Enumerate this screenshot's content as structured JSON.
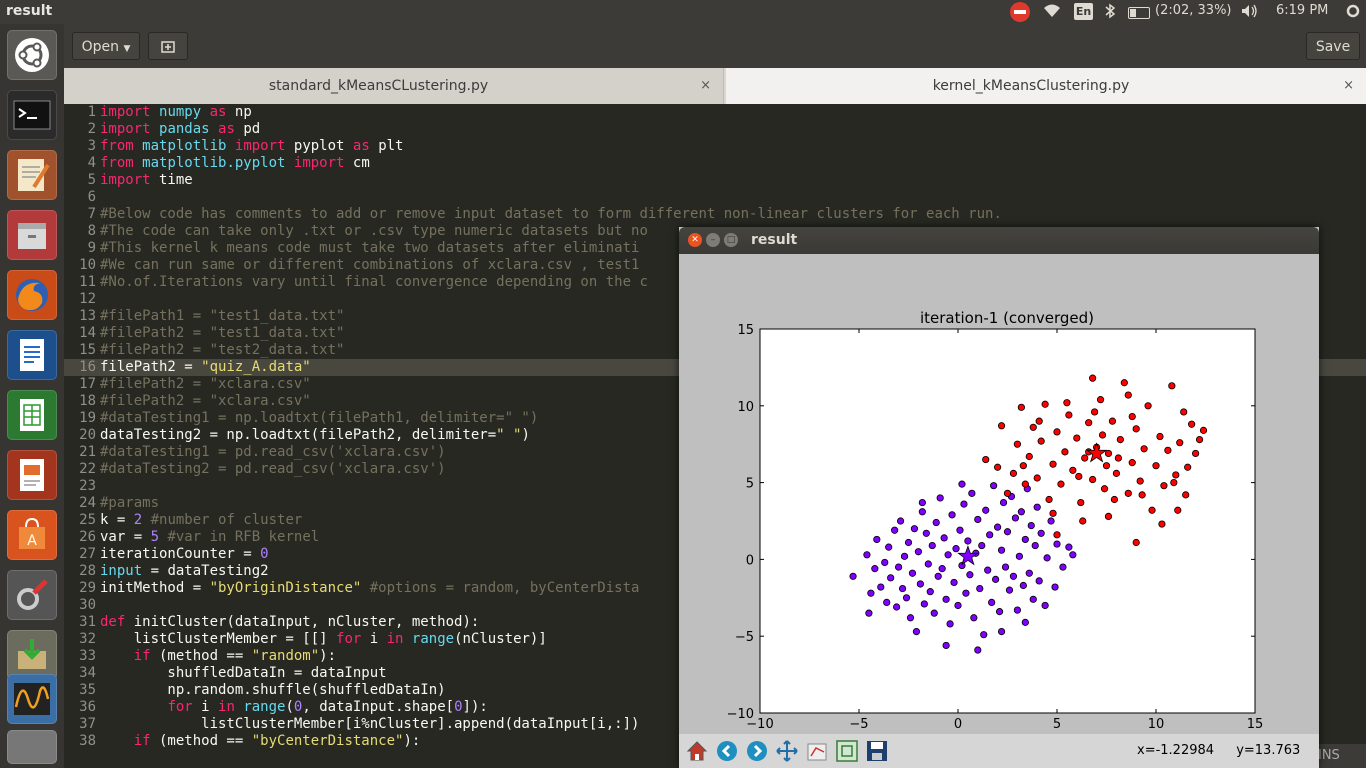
{
  "topbar": {
    "title": "result",
    "battery": "(2:02, 33%)",
    "time": "6:19 PM",
    "lang": "En"
  },
  "toolbar": {
    "open_label": "Open",
    "save_label": "Save"
  },
  "tabs": [
    {
      "label": "standard_kMeansCLustering.py",
      "close": "×"
    },
    {
      "label": "kernel_kMeansClustering.py",
      "close": "×"
    }
  ],
  "editor": {
    "current_line": 16,
    "lines": [
      {
        "n": "1",
        "text": "import numpy as np"
      },
      {
        "n": "2",
        "text": "import pandas as pd"
      },
      {
        "n": "3",
        "text": "from matplotlib import pyplot as plt"
      },
      {
        "n": "4",
        "text": "from matplotlib.pyplot import cm"
      },
      {
        "n": "5",
        "text": "import time"
      },
      {
        "n": "6",
        "text": ""
      },
      {
        "n": "7",
        "text": "#Below code has comments to add or remove input dataset to form different non-linear clusters for each run."
      },
      {
        "n": "8",
        "text": "#The code can take only .txt or .csv type numeric datasets but no"
      },
      {
        "n": "9",
        "text": "#This kernel k means code must take two datasets after eliminati"
      },
      {
        "n": "10",
        "text": "#We can run same or different combinations of xclara.csv , test1"
      },
      {
        "n": "11",
        "text": "#No.of.Iterations vary until final convergence depending on the c"
      },
      {
        "n": "12",
        "text": ""
      },
      {
        "n": "13",
        "text": "#filePath1 = \"test1_data.txt\""
      },
      {
        "n": "14",
        "text": "#filePath2 = \"test1_data.txt\""
      },
      {
        "n": "15",
        "text": "#filePath2 = \"test2_data.txt\""
      },
      {
        "n": "16",
        "text": "filePath2 = \"quiz_A.data\""
      },
      {
        "n": "17",
        "text": "#filePath2 = \"xclara.csv\""
      },
      {
        "n": "18",
        "text": "#filePath2 = \"xclara.csv\""
      },
      {
        "n": "19",
        "text": "#dataTesting1 = np.loadtxt(filePath1, delimiter=\" \")"
      },
      {
        "n": "20",
        "text": "dataTesting2 = np.loadtxt(filePath2, delimiter=\" \")"
      },
      {
        "n": "21",
        "text": "#dataTesting1 = pd.read_csv('xclara.csv')"
      },
      {
        "n": "22",
        "text": "#dataTesting2 = pd.read_csv('xclara.csv')"
      },
      {
        "n": "23",
        "text": ""
      },
      {
        "n": "24",
        "text": "#params"
      },
      {
        "n": "25",
        "text": "k = 2 #number of cluster"
      },
      {
        "n": "26",
        "text": "var = 5 #var in RFB kernel"
      },
      {
        "n": "27",
        "text": "iterationCounter = 0"
      },
      {
        "n": "28",
        "text": "input = dataTesting2"
      },
      {
        "n": "29",
        "text": "initMethod = \"byOriginDistance\" #options = random, byCenterDista"
      },
      {
        "n": "30",
        "text": ""
      },
      {
        "n": "31",
        "text": "def initCluster(dataInput, nCluster, method):"
      },
      {
        "n": "32",
        "text": "    listClusterMember = [[] for i in range(nCluster)]"
      },
      {
        "n": "33",
        "text": "    if (method == \"random\"):"
      },
      {
        "n": "34",
        "text": "        shuffledDataIn = dataInput"
      },
      {
        "n": "35",
        "text": "        np.random.shuffle(shuffledDataIn)"
      },
      {
        "n": "36",
        "text": "        for i in range(0, dataInput.shape[0]):"
      },
      {
        "n": "37",
        "text": "            listClusterMember[i%nCluster].append(dataInput[i,:])"
      },
      {
        "n": "38",
        "text": "    if (method == \"byCenterDistance\"):"
      }
    ]
  },
  "status": {
    "mode": "INS"
  },
  "result_window": {
    "title": "result",
    "coords": {
      "x": "x=-1.22984",
      "y": "y=13.763"
    }
  },
  "chart_data": {
    "type": "scatter",
    "title": "iteration-1 (converged)",
    "xlabel": "",
    "ylabel": "",
    "xlim": [
      -10,
      15
    ],
    "ylim": [
      -10,
      15
    ],
    "xticks": [
      "−10",
      "−5",
      "0",
      "5",
      "10",
      "15"
    ],
    "yticks": [
      "−10",
      "−5",
      "0",
      "5",
      "10",
      "15"
    ],
    "grid": false,
    "series": [
      {
        "color": "#8000ff",
        "centroid": [
          0.5,
          0.2
        ],
        "points": [
          [
            -5.3,
            -1.1
          ],
          [
            -4.6,
            0.3
          ],
          [
            -4.5,
            -3.5
          ],
          [
            -4.4,
            -2.2
          ],
          [
            -4.2,
            -0.6
          ],
          [
            -4.1,
            1.3
          ],
          [
            -3.9,
            -1.8
          ],
          [
            -3.7,
            -0.2
          ],
          [
            -3.6,
            -2.8
          ],
          [
            -3.5,
            0.8
          ],
          [
            -3.4,
            -1.2
          ],
          [
            -3.2,
            1.9
          ],
          [
            -3.1,
            -3.1
          ],
          [
            -3.0,
            -0.5
          ],
          [
            -2.9,
            2.5
          ],
          [
            -2.8,
            -1.9
          ],
          [
            -2.7,
            0.2
          ],
          [
            -2.6,
            -2.5
          ],
          [
            -2.5,
            1.1
          ],
          [
            -2.4,
            -3.8
          ],
          [
            -2.3,
            -0.9
          ],
          [
            -2.2,
            2.0
          ],
          [
            -2.1,
            -4.7
          ],
          [
            -2.0,
            0.5
          ],
          [
            -1.9,
            -1.6
          ],
          [
            -1.8,
            3.1
          ],
          [
            -1.7,
            -2.9
          ],
          [
            -1.6,
            1.7
          ],
          [
            -1.5,
            -0.3
          ],
          [
            -1.4,
            -2.1
          ],
          [
            -1.3,
            0.9
          ],
          [
            -1.2,
            -3.5
          ],
          [
            -1.1,
            2.4
          ],
          [
            -1.0,
            -1.1
          ],
          [
            -0.9,
            4.0
          ],
          [
            -0.8,
            -0.6
          ],
          [
            -0.7,
            1.4
          ],
          [
            -0.6,
            -2.6
          ],
          [
            -0.5,
            0.3
          ],
          [
            -0.4,
            -4.2
          ],
          [
            -0.3,
            2.9
          ],
          [
            -0.2,
            -1.5
          ],
          [
            -0.1,
            0.7
          ],
          [
            0.0,
            -3.0
          ],
          [
            0.1,
            1.9
          ],
          [
            0.2,
            -0.4
          ],
          [
            0.3,
            3.6
          ],
          [
            0.4,
            -2.2
          ],
          [
            0.5,
            1.2
          ],
          [
            0.6,
            -1.0
          ],
          [
            0.7,
            4.3
          ],
          [
            0.8,
            -3.8
          ],
          [
            0.9,
            0.4
          ],
          [
            1.0,
            2.6
          ],
          [
            1.1,
            -1.9
          ],
          [
            1.2,
            0.9
          ],
          [
            1.3,
            -4.9
          ],
          [
            1.4,
            3.2
          ],
          [
            1.5,
            -0.7
          ],
          [
            1.6,
            1.6
          ],
          [
            1.7,
            -2.8
          ],
          [
            1.8,
            4.8
          ],
          [
            1.9,
            -1.3
          ],
          [
            2.0,
            2.1
          ],
          [
            2.1,
            -3.4
          ],
          [
            2.2,
            0.6
          ],
          [
            2.3,
            3.7
          ],
          [
            2.4,
            -0.5
          ],
          [
            2.5,
            1.8
          ],
          [
            2.6,
            -2.0
          ],
          [
            2.7,
            4.1
          ],
          [
            2.8,
            -1.1
          ],
          [
            2.9,
            2.7
          ],
          [
            3.0,
            -3.3
          ],
          [
            3.1,
            0.2
          ],
          [
            3.2,
            3.1
          ],
          [
            3.3,
            -1.7
          ],
          [
            3.4,
            1.3
          ],
          [
            3.5,
            4.6
          ],
          [
            3.6,
            -0.9
          ],
          [
            3.7,
            2.2
          ],
          [
            3.8,
            -2.6
          ],
          [
            3.9,
            0.9
          ],
          [
            4.0,
            3.4
          ],
          [
            4.1,
            -1.4
          ],
          [
            4.2,
            1.7
          ],
          [
            4.4,
            -3.0
          ],
          [
            4.5,
            0.1
          ],
          [
            4.7,
            2.5
          ],
          [
            4.9,
            -1.8
          ],
          [
            5.0,
            1.0
          ],
          [
            5.3,
            -0.5
          ],
          [
            5.6,
            0.8
          ],
          [
            -0.6,
            -5.6
          ],
          [
            1.0,
            -5.9
          ],
          [
            2.2,
            -4.7
          ],
          [
            3.4,
            -4.1
          ],
          [
            -1.8,
            3.7
          ],
          [
            0.2,
            4.9
          ],
          [
            5.8,
            0.3
          ]
        ]
      },
      {
        "color": "#ff0000",
        "centroid": [
          7.0,
          6.9
        ],
        "points": [
          [
            1.4,
            6.5
          ],
          [
            2.0,
            6.0
          ],
          [
            2.2,
            8.7
          ],
          [
            2.5,
            4.3
          ],
          [
            2.8,
            5.6
          ],
          [
            3.0,
            7.5
          ],
          [
            3.2,
            9.9
          ],
          [
            3.4,
            4.9
          ],
          [
            3.6,
            6.7
          ],
          [
            3.8,
            8.6
          ],
          [
            4.0,
            5.3
          ],
          [
            4.2,
            7.7
          ],
          [
            4.4,
            10.1
          ],
          [
            4.6,
            3.9
          ],
          [
            4.8,
            6.2
          ],
          [
            5.0,
            8.3
          ],
          [
            5.2,
            4.9
          ],
          [
            5.4,
            7.0
          ],
          [
            5.6,
            9.4
          ],
          [
            5.8,
            5.8
          ],
          [
            6.0,
            7.9
          ],
          [
            6.2,
            3.7
          ],
          [
            6.4,
            6.6
          ],
          [
            6.6,
            8.9
          ],
          [
            6.8,
            5.2
          ],
          [
            7.0,
            7.3
          ],
          [
            7.2,
            10.4
          ],
          [
            7.4,
            4.6
          ],
          [
            7.6,
            6.9
          ],
          [
            7.8,
            9.0
          ],
          [
            8.0,
            5.6
          ],
          [
            8.2,
            7.8
          ],
          [
            8.4,
            11.5
          ],
          [
            8.6,
            4.3
          ],
          [
            8.8,
            6.3
          ],
          [
            9.0,
            8.5
          ],
          [
            9.2,
            5.1
          ],
          [
            9.4,
            7.2
          ],
          [
            9.6,
            10.0
          ],
          [
            9.8,
            3.2
          ],
          [
            10.0,
            6.1
          ],
          [
            10.2,
            8.0
          ],
          [
            10.4,
            4.8
          ],
          [
            10.6,
            7.1
          ],
          [
            10.8,
            11.3
          ],
          [
            11.0,
            5.5
          ],
          [
            11.2,
            7.6
          ],
          [
            11.4,
            9.6
          ],
          [
            11.6,
            6.0
          ],
          [
            11.8,
            8.8
          ],
          [
            12.0,
            6.9
          ],
          [
            12.2,
            7.8
          ],
          [
            12.4,
            8.4
          ],
          [
            5.0,
            1.6
          ],
          [
            6.3,
            2.5
          ],
          [
            7.6,
            2.8
          ],
          [
            9.0,
            1.1
          ],
          [
            10.3,
            2.3
          ],
          [
            11.1,
            3.2
          ],
          [
            6.8,
            11.8
          ],
          [
            8.6,
            10.7
          ],
          [
            4.8,
            3.0
          ],
          [
            7.9,
            3.9
          ],
          [
            9.3,
            4.2
          ],
          [
            6.1,
            5.4
          ],
          [
            7.3,
            8.1
          ],
          [
            8.1,
            6.6
          ],
          [
            6.6,
            7.0
          ],
          [
            7.5,
            6.1
          ],
          [
            6.9,
            9.6
          ],
          [
            8.8,
            9.3
          ],
          [
            5.5,
            10.2
          ],
          [
            4.1,
            9.0
          ],
          [
            3.3,
            6.1
          ],
          [
            10.9,
            5.0
          ],
          [
            11.5,
            4.2
          ]
        ]
      }
    ]
  }
}
